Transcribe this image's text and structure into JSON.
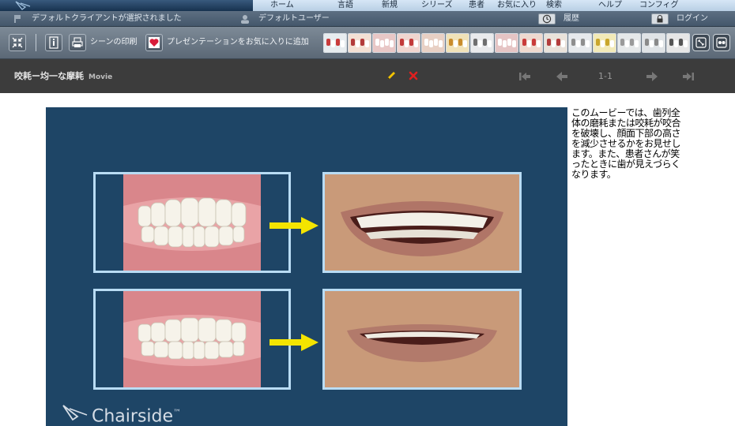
{
  "menu": {
    "items": [
      "ホーム",
      "言語",
      "新規",
      "シリーズ",
      "患者",
      "お気に入り",
      "検索",
      "ヘルプ",
      "コンフィグ"
    ]
  },
  "status": {
    "client": "デフォルトクライアントが選択されました",
    "user": "デフォルトユーザー",
    "history": "履歴",
    "login": "ログイン"
  },
  "toolbar": {
    "print_label": "シーンの印刷",
    "favorite_label": "プレゼンテーションをお気に入りに追加"
  },
  "title": {
    "name": "咬耗ー均一な摩耗",
    "type": "Movie",
    "page": "1-1"
  },
  "media": {
    "brand": "Chairside",
    "brand_tm": "™"
  },
  "description": "このムービーでは、歯列全体の磨耗または咬耗が咬合を破壊し、顔面下部の高さを減少させるかをお見せします。また、患者さんが笑ったときに歯が見えづらくなります。",
  "colors": {
    "accent_arrow": "#f4e400",
    "media_bg": "#1e4566",
    "panel_border": "#b9dcf4",
    "delete_x": "#e02020",
    "edit_pencil": "#f4c400"
  },
  "icons": {
    "thumbnail_count": 15
  }
}
